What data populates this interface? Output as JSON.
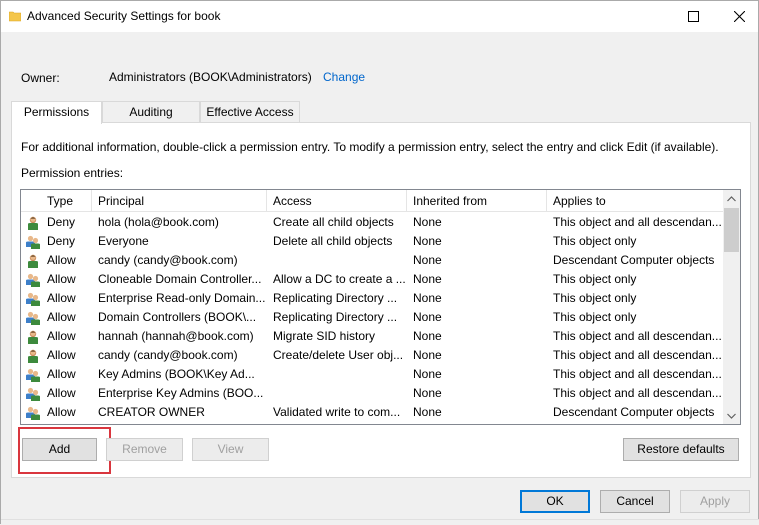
{
  "window": {
    "title": "Advanced Security Settings for book"
  },
  "owner": {
    "label": "Owner:",
    "value": "Administrators (BOOK\\Administrators)",
    "change": "Change"
  },
  "tabs": [
    {
      "label": "Permissions",
      "active": true
    },
    {
      "label": "Auditing",
      "active": false
    },
    {
      "label": "Effective Access",
      "active": false
    }
  ],
  "info_text": "For additional information, double-click a permission entry. To modify a permission entry, select the entry and click Edit (if available).",
  "entries_label": "Permission entries:",
  "columns": [
    "Type",
    "Principal",
    "Access",
    "Inherited from",
    "Applies to"
  ],
  "rows": [
    {
      "icon": "user-icon",
      "type": "Deny",
      "principal": "hola (hola@book.com)",
      "access": "Create all child objects",
      "inherited": "None",
      "applies": "This object and all descendan..."
    },
    {
      "icon": "group-icon",
      "type": "Deny",
      "principal": "Everyone",
      "access": "Delete all child objects",
      "inherited": "None",
      "applies": "This object only"
    },
    {
      "icon": "user-icon",
      "type": "Allow",
      "principal": "candy (candy@book.com)",
      "access": "",
      "inherited": "None",
      "applies": "Descendant Computer objects"
    },
    {
      "icon": "group-icon",
      "type": "Allow",
      "principal": "Cloneable Domain Controller...",
      "access": "Allow a DC to create a ...",
      "inherited": "None",
      "applies": "This object only"
    },
    {
      "icon": "group-icon",
      "type": "Allow",
      "principal": "Enterprise Read-only Domain...",
      "access": "Replicating Directory ...",
      "inherited": "None",
      "applies": "This object only"
    },
    {
      "icon": "group-icon",
      "type": "Allow",
      "principal": "Domain Controllers (BOOK\\...",
      "access": "Replicating Directory ...",
      "inherited": "None",
      "applies": "This object only"
    },
    {
      "icon": "user-icon",
      "type": "Allow",
      "principal": "hannah (hannah@book.com)",
      "access": "Migrate SID history",
      "inherited": "None",
      "applies": "This object and all descendan..."
    },
    {
      "icon": "user-icon",
      "type": "Allow",
      "principal": "candy (candy@book.com)",
      "access": "Create/delete User obj...",
      "inherited": "None",
      "applies": "This object and all descendan..."
    },
    {
      "icon": "group-icon",
      "type": "Allow",
      "principal": "Key Admins (BOOK\\Key Ad...",
      "access": "",
      "inherited": "None",
      "applies": "This object and all descendan..."
    },
    {
      "icon": "group-icon",
      "type": "Allow",
      "principal": "Enterprise Key Admins (BOO...",
      "access": "",
      "inherited": "None",
      "applies": "This object and all descendan..."
    },
    {
      "icon": "group-icon",
      "type": "Allow",
      "principal": "CREATOR OWNER",
      "access": "Validated write to com...",
      "inherited": "None",
      "applies": "Descendant Computer objects"
    }
  ],
  "buttons": {
    "add": "Add",
    "remove": "Remove",
    "view": "View",
    "restore": "Restore defaults",
    "ok": "OK",
    "cancel": "Cancel",
    "apply": "Apply"
  },
  "colors": {
    "link": "#0066cc",
    "highlight": "#d9363e",
    "accent": "#0078d7"
  }
}
